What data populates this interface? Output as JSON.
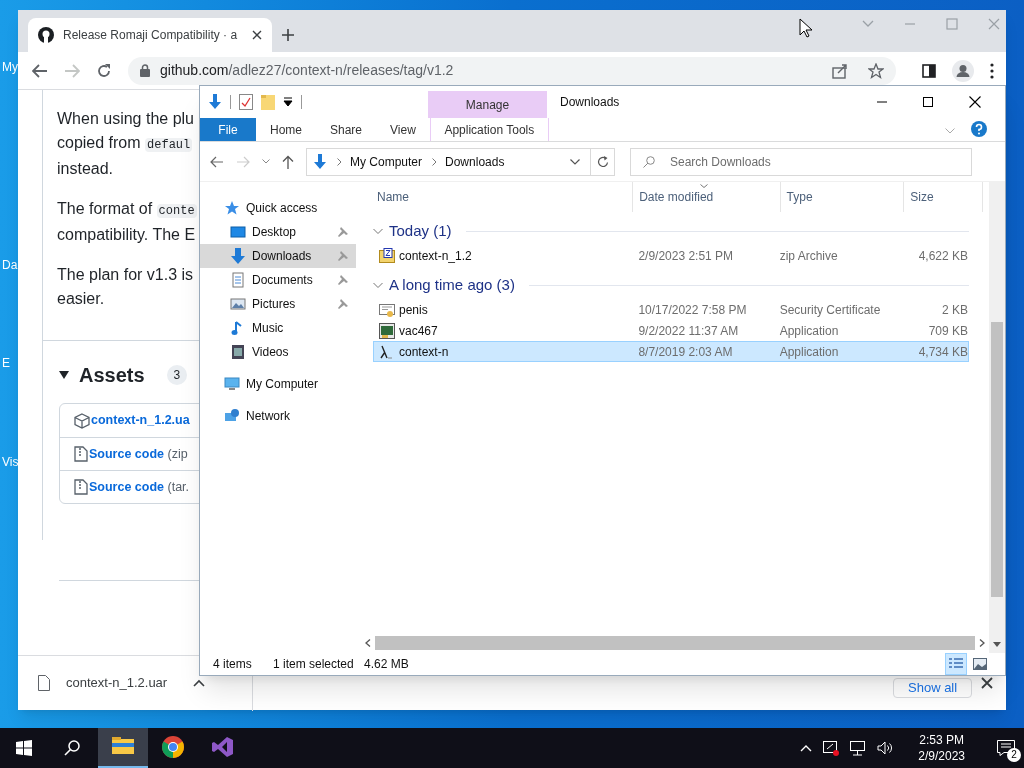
{
  "desktop": {
    "icons": [
      {
        "label": "My"
      },
      {
        "label": "Da"
      },
      {
        "label": "E"
      },
      {
        "label": "Vis"
      }
    ]
  },
  "browser": {
    "tab": {
      "title": "Release Romaji Compatibility · a"
    },
    "url": {
      "host": "github.com",
      "path": "/adlez27/context-n/releases/tag/v1.2"
    },
    "page": {
      "paragraphs": [
        [
          [
            {
              "kind": "text",
              "text": "When using the plu"
            }
          ],
          [
            {
              "kind": "text",
              "text": "copied from "
            },
            {
              "kind": "code",
              "text": "defaul"
            }
          ],
          [
            {
              "kind": "text",
              "text": "instead."
            }
          ]
        ],
        [
          [
            {
              "kind": "text",
              "text": "The format of "
            },
            {
              "kind": "code",
              "text": "conte"
            }
          ],
          [
            {
              "kind": "text",
              "text": "compatibility. The E"
            }
          ]
        ],
        [
          [
            {
              "kind": "text",
              "text": "The plan for v1.3 is"
            }
          ],
          [
            {
              "kind": "text",
              "text": "easier."
            }
          ]
        ]
      ],
      "assets": {
        "title": "Assets",
        "count": "3",
        "expanded": true,
        "items": [
          {
            "kind": "package",
            "name": "context-n_1.2.ua"
          },
          {
            "kind": "archive",
            "name": "Source code",
            "ext": "(zip"
          },
          {
            "kind": "archive",
            "name": "Source code",
            "ext": "(tar."
          }
        ]
      }
    },
    "download_bar": {
      "file": "context-n_1.2.uar",
      "show_all": "Show all"
    }
  },
  "explorer": {
    "title": "Downloads",
    "ribbon_tabs": [
      {
        "kind": "menu",
        "label": "File",
        "selected": false
      },
      {
        "kind": "tab",
        "label": "Home",
        "selected": false
      },
      {
        "kind": "tab",
        "label": "Share",
        "selected": false
      },
      {
        "kind": "tab",
        "label": "View",
        "selected": false
      },
      {
        "kind": "context",
        "group": "Manage",
        "label": "Application Tools",
        "selected": false
      }
    ],
    "breadcrumb": [
      "My Computer",
      "Downloads"
    ],
    "search": {
      "placeholder": "Search Downloads"
    },
    "nav_pane": [
      {
        "kind": "quick",
        "label": "Quick access",
        "selected": false,
        "children": [
          {
            "kind": "desktop",
            "label": "Desktop",
            "pinned": true,
            "selected": false
          },
          {
            "kind": "downloads",
            "label": "Downloads",
            "pinned": true,
            "selected": true
          },
          {
            "kind": "documents",
            "label": "Documents",
            "pinned": true,
            "selected": false
          },
          {
            "kind": "pictures",
            "label": "Pictures",
            "pinned": true,
            "selected": false
          },
          {
            "kind": "music",
            "label": "Music",
            "pinned": false,
            "selected": false
          },
          {
            "kind": "videos",
            "label": "Videos",
            "pinned": false,
            "selected": false
          }
        ]
      },
      {
        "kind": "computer",
        "label": "My Computer",
        "selected": false
      },
      {
        "kind": "network",
        "label": "Network",
        "selected": false
      }
    ],
    "columns": [
      "Name",
      "Date modified",
      "Type",
      "Size"
    ],
    "groups": [
      {
        "title": "Today (1)",
        "expanded": true,
        "files": [
          {
            "kind": "zip",
            "name": "context-n_1.2",
            "date": "2/9/2023 2:51 PM",
            "type": "zip Archive",
            "size": "4,622 KB",
            "selected": false
          }
        ]
      },
      {
        "title": "A long time ago (3)",
        "expanded": true,
        "files": [
          {
            "kind": "certificate",
            "name": "penis",
            "date": "10/17/2022 7:58 PM",
            "type": "Security Certificate",
            "size": "2 KB",
            "selected": false
          },
          {
            "kind": "app",
            "name": "vac467",
            "date": "9/2/2022 11:37 AM",
            "type": "Application",
            "size": "709 KB",
            "selected": false
          },
          {
            "kind": "lambda",
            "name": "context-n",
            "date": "8/7/2019 2:03 AM",
            "type": "Application",
            "size": "4,734 KB",
            "selected": true
          }
        ]
      }
    ],
    "status": {
      "count": "4 items",
      "selection": "1 item selected",
      "size": "4.62 MB"
    },
    "views": [
      {
        "kind": "details",
        "selected": true
      },
      {
        "kind": "large_icons",
        "selected": false
      }
    ]
  },
  "taskbar": {
    "apps": [
      {
        "kind": "file_explorer",
        "active": true
      },
      {
        "kind": "chrome",
        "active": false
      },
      {
        "kind": "visual_studio",
        "active": false
      }
    ],
    "time": "2:53 PM",
    "date": "2/9/2023",
    "notifications": "2"
  }
}
